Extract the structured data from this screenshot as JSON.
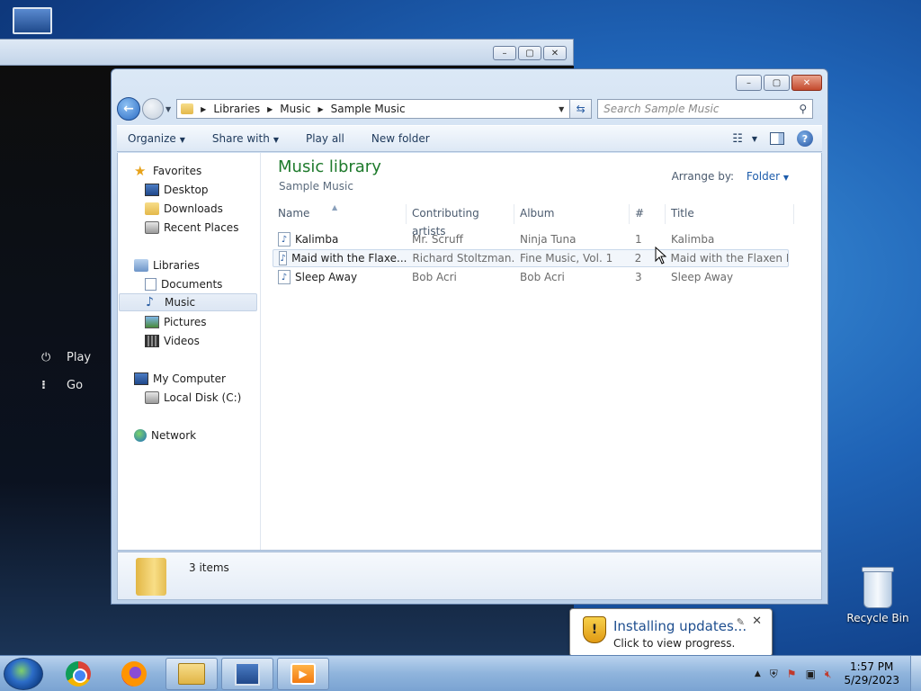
{
  "desktop": {
    "recycle_bin_label": "Recycle Bin"
  },
  "media_player": {
    "items": [
      "Play",
      "Go"
    ]
  },
  "explorer": {
    "address": {
      "crumbs": [
        "Libraries",
        "Music",
        "Sample Music"
      ]
    },
    "search_placeholder": "Search Sample Music",
    "commands": {
      "organize": "Organize",
      "share_with": "Share with",
      "play_all": "Play all",
      "new_folder": "New folder"
    },
    "nav": {
      "favorites": "Favorites",
      "desktop": "Desktop",
      "downloads": "Downloads",
      "recent_places": "Recent Places",
      "libraries": "Libraries",
      "documents": "Documents",
      "music": "Music",
      "pictures": "Pictures",
      "videos": "Videos",
      "my_computer": "My Computer",
      "local_disk": "Local Disk (C:)",
      "network": "Network"
    },
    "library": {
      "title": "Music library",
      "subtitle": "Sample Music",
      "arrange_label": "Arrange by:",
      "arrange_value": "Folder"
    },
    "columns": {
      "name": "Name",
      "artists": "Contributing artists",
      "album": "Album",
      "number": "#",
      "title": "Title"
    },
    "rows": [
      {
        "name": "Kalimba",
        "artist": "Mr. Scruff",
        "album": "Ninja Tuna",
        "number": "1",
        "title": "Kalimba"
      },
      {
        "name": "Maid with the Flaxe...",
        "artist": "Richard Stoltzman...",
        "album": "Fine Music, Vol. 1",
        "number": "2",
        "title": "Maid with the Flaxen H..."
      },
      {
        "name": "Sleep Away",
        "artist": "Bob Acri",
        "album": "Bob Acri",
        "number": "3",
        "title": "Sleep Away"
      }
    ],
    "status": {
      "item_count": "3 items"
    }
  },
  "notification": {
    "title": "Installing updates...",
    "message": "Click to view progress."
  },
  "taskbar": {
    "time": "1:57 PM",
    "date": "5/29/2023"
  }
}
